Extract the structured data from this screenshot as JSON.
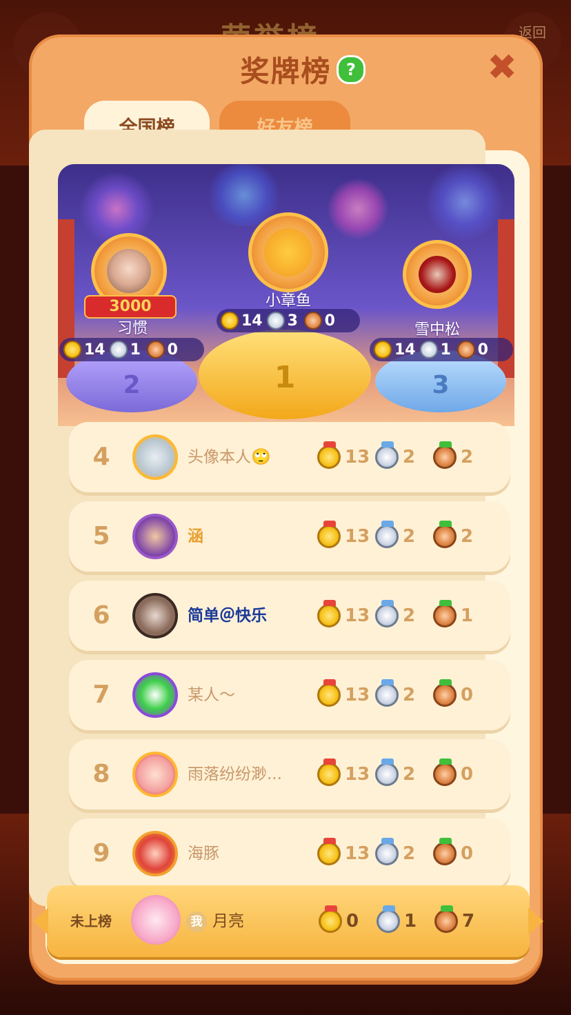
{
  "background": {
    "title": "荣誉榜",
    "back_label": "返回"
  },
  "modal": {
    "title": "奖牌榜",
    "help_icon": "?",
    "close_icon": "✖"
  },
  "tabs": [
    {
      "label": "全国榜",
      "active": true
    },
    {
      "label": "好友榜",
      "active": false
    }
  ],
  "podium": [
    {
      "rank": 1,
      "rank_label": "1",
      "name": "小章鱼",
      "gold": 14,
      "silver": 3,
      "bronze": 0
    },
    {
      "rank": 2,
      "rank_label": "2",
      "name": "习惯",
      "gold": 14,
      "silver": 1,
      "bronze": 0,
      "badge": "3000"
    },
    {
      "rank": 3,
      "rank_label": "3",
      "name": "雪中松",
      "gold": 14,
      "silver": 1,
      "bronze": 0
    }
  ],
  "rows": [
    {
      "rank": "4",
      "name": "头像本人🙄",
      "gold": 13,
      "silver": 2,
      "bronze": 2
    },
    {
      "rank": "5",
      "name": "涵",
      "gold": 13,
      "silver": 2,
      "bronze": 2
    },
    {
      "rank": "6",
      "name": "简单＠快乐",
      "gold": 13,
      "silver": 2,
      "bronze": 1
    },
    {
      "rank": "7",
      "name": "某人～",
      "gold": 13,
      "silver": 2,
      "bronze": 0
    },
    {
      "rank": "8",
      "name": "雨落纷纷渺...",
      "gold": 13,
      "silver": 2,
      "bronze": 0
    },
    {
      "rank": "9",
      "name": "海豚",
      "gold": 13,
      "silver": 2,
      "bronze": 0
    }
  ],
  "self": {
    "rank_label": "未上榜",
    "me_badge": "我",
    "name": "月亮",
    "gold": 0,
    "silver": 1,
    "bronze": 7
  },
  "colors": {
    "modal": "#f3a866",
    "panel": "#fff6df",
    "row": "#fff1d6",
    "accent_title": "#a84d1d",
    "self_row": "#f7b440"
  }
}
